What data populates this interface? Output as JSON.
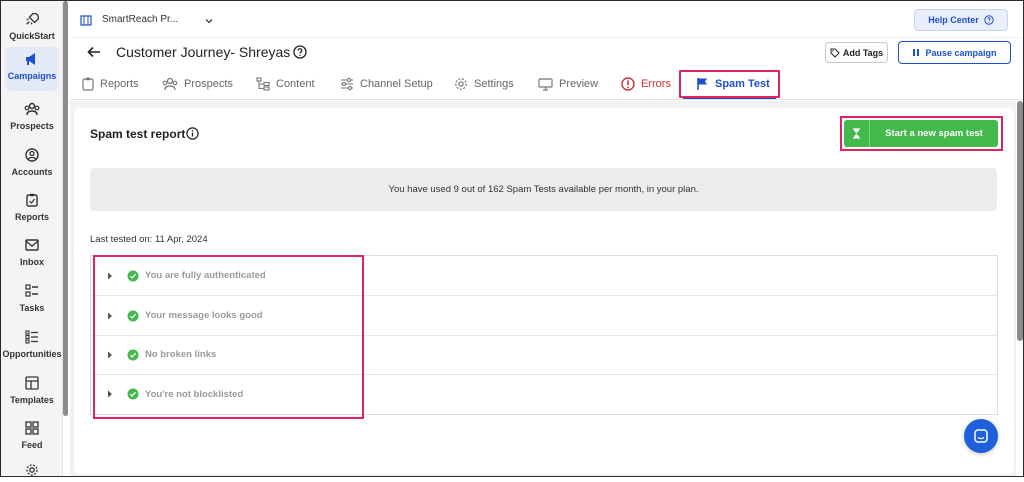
{
  "sidebar": {
    "items": [
      {
        "label": "QuickStart",
        "icon": "rocket-icon"
      },
      {
        "label": "Campaigns",
        "icon": "megaphone-icon"
      },
      {
        "label": "Prospects",
        "icon": "users-icon"
      },
      {
        "label": "Accounts",
        "icon": "user-circle-icon"
      },
      {
        "label": "Reports",
        "icon": "clipboard-icon"
      },
      {
        "label": "Inbox",
        "icon": "mail-icon"
      },
      {
        "label": "Tasks",
        "icon": "checklist-icon"
      },
      {
        "label": "Opportunities",
        "icon": "list-icon"
      },
      {
        "label": "Templates",
        "icon": "template-icon"
      },
      {
        "label": "Feed",
        "icon": "grid-icon"
      }
    ],
    "active_index": 1
  },
  "header": {
    "workspace": "SmartReach Pr...",
    "help_label": "Help Center"
  },
  "campaign": {
    "title": "Customer Journey- Shreyas",
    "add_tags_label": "Add Tags",
    "pause_label": "Pause campaign"
  },
  "tabs": [
    {
      "label": "Reports",
      "icon": "clipboard-icon"
    },
    {
      "label": "Prospects",
      "icon": "users-icon"
    },
    {
      "label": "Content",
      "icon": "content-icon"
    },
    {
      "label": "Channel Setup",
      "icon": "sliders-icon"
    },
    {
      "label": "Settings",
      "icon": "gear-icon"
    },
    {
      "label": "Preview",
      "icon": "monitor-icon"
    },
    {
      "label": "Errors",
      "icon": "alert-icon"
    },
    {
      "label": "Spam Test",
      "icon": "flag-icon"
    }
  ],
  "spam": {
    "report_title": "Spam test report",
    "new_test_label": "Start a new spam test",
    "usage_text": "You have used 9 out of 162 Spam Tests available per month, in your plan.",
    "last_tested": "Last tested on: 11 Apr, 2024",
    "results": [
      "You are fully authenticated",
      "Your message looks good",
      "No broken links",
      "You're not blocklisted"
    ]
  },
  "colors": {
    "accent": "#1f4fd1",
    "success": "#43b84b",
    "error": "#d32f2f",
    "highlight": "#e0245e"
  }
}
